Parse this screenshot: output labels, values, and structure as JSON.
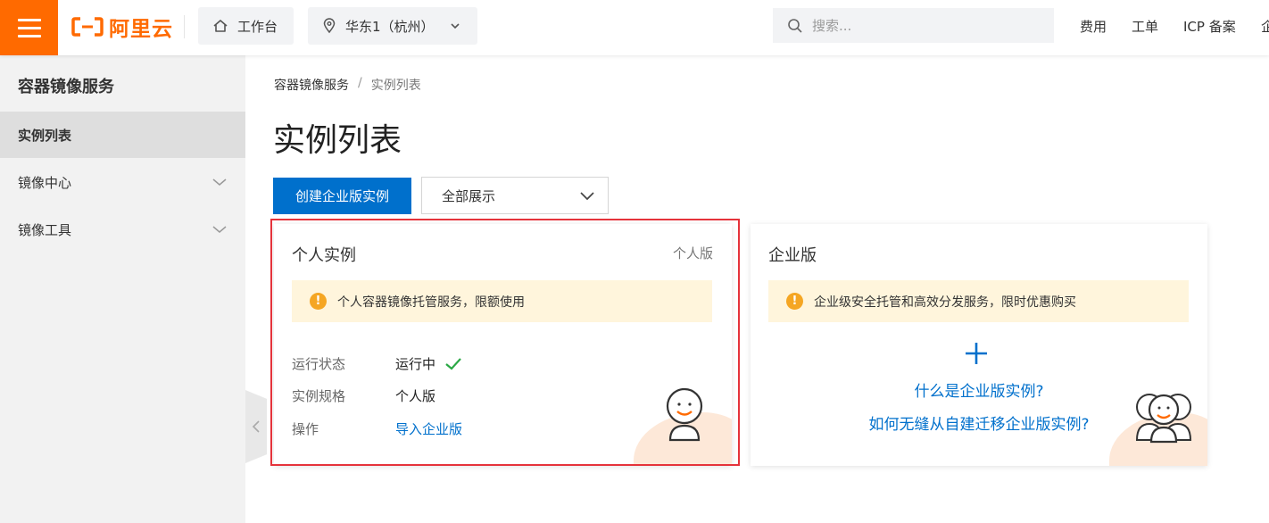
{
  "header": {
    "logo_text": "阿里云",
    "workbench_label": "工作台",
    "region_label": "华东1（杭州）",
    "search_placeholder": "搜索...",
    "nav": [
      "费用",
      "工单",
      "ICP 备案",
      "企"
    ]
  },
  "sidebar": {
    "title": "容器镜像服务",
    "items": [
      {
        "label": "实例列表",
        "active": true,
        "expandable": false
      },
      {
        "label": "镜像中心",
        "active": false,
        "expandable": true
      },
      {
        "label": "镜像工具",
        "active": false,
        "expandable": true
      }
    ]
  },
  "breadcrumb": [
    "容器镜像服务",
    "/",
    "实例列表"
  ],
  "page_title": "实例列表",
  "toolbar": {
    "create_label": "创建企业版实例",
    "filter_value": "全部展示"
  },
  "personal_card": {
    "title": "个人实例",
    "tag": "个人版",
    "notice": "个人容器镜像托管服务，限额使用",
    "rows": [
      {
        "label": "运行状态",
        "value": "运行中"
      },
      {
        "label": "实例规格",
        "value": "个人版"
      },
      {
        "label": "操作",
        "value": "导入企业版"
      }
    ]
  },
  "enterprise_card": {
    "title": "企业版",
    "notice": "企业级安全托管和高效分发服务，限时优惠购买",
    "link_what": "什么是企业版实例?",
    "link_migrate": "如何无缝从自建迁移企业版实例?"
  },
  "colors": {
    "brand_orange": "#ff6a00",
    "primary_blue": "#0070cc",
    "success_green": "#2aa845",
    "warning_bg": "#fff5dc",
    "highlight_red": "#e5333b"
  }
}
